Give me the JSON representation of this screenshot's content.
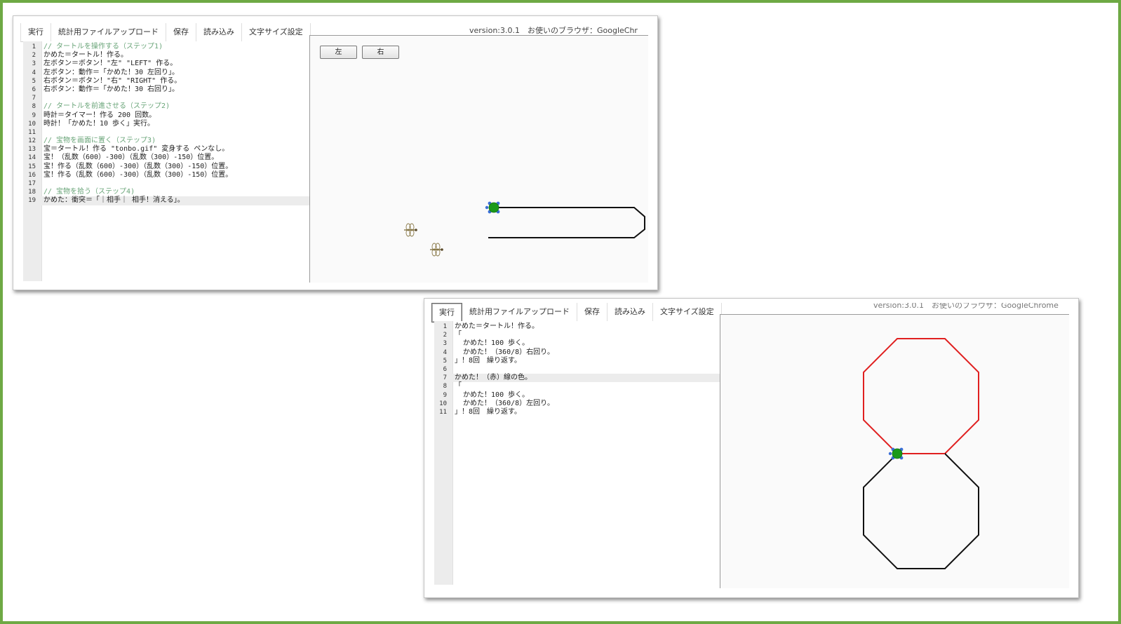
{
  "window1": {
    "toolbar": [
      "実行",
      "統計用ファイルアップロード",
      "保存",
      "読み込み",
      "文字サイズ設定"
    ],
    "version": "version:3.0.1　お使いのブラウザ：GoogleChr",
    "stage_buttons": {
      "left": "左",
      "right": "右"
    },
    "active_line": 19,
    "code": [
      {
        "n": "1",
        "text": "// タートルを操作する（ステップ1)",
        "type": "comment"
      },
      {
        "n": "2",
        "text": "かめた＝タートル！作る。",
        "type": "code"
      },
      {
        "n": "3",
        "text": "左ボタン＝ボタン！\"左\" \"LEFT\" 作る。",
        "type": "code"
      },
      {
        "n": "4",
        "text": "左ボタン：動作＝「かめた！30 左回り」。",
        "type": "code"
      },
      {
        "n": "5",
        "text": "右ボタン＝ボタン！\"右\" \"RIGHT\" 作る。",
        "type": "code"
      },
      {
        "n": "6",
        "text": "右ボタン：動作＝「かめた！30 右回り」。",
        "type": "code"
      },
      {
        "n": "7",
        "text": "",
        "type": "code"
      },
      {
        "n": "8",
        "text": "// タートルを前進させる（ステップ2)",
        "type": "comment"
      },
      {
        "n": "9",
        "text": "時計＝タイマー！作る 200 回数。",
        "type": "code"
      },
      {
        "n": "10",
        "text": "時計！「かめた！10 歩く」実行。",
        "type": "code"
      },
      {
        "n": "11",
        "text": "",
        "type": "code"
      },
      {
        "n": "12",
        "text": "// 宝物を画面に置く（ステップ3)",
        "type": "comment"
      },
      {
        "n": "13",
        "text": "宝＝タートル！作る \"tonbo.gif\" 変身する ペンなし。",
        "type": "code"
      },
      {
        "n": "14",
        "text": "宝！（乱数（600）-300）（乱数（300）-150）位置。",
        "type": "code"
      },
      {
        "n": "15",
        "text": "宝！作る（乱数（600）-300）（乱数（300）-150）位置。",
        "type": "code"
      },
      {
        "n": "16",
        "text": "宝！作る（乱数（600）-300）（乱数（300）-150）位置。",
        "type": "code"
      },
      {
        "n": "17",
        "text": "",
        "type": "code"
      },
      {
        "n": "18",
        "text": "// 宝物を拾う（ステップ4)",
        "type": "comment"
      },
      {
        "n": "19",
        "text": "かめた：衝突＝「｜相手｜ 相手！消える」。",
        "type": "code"
      }
    ]
  },
  "window2": {
    "toolbar": [
      "実行",
      "統計用ファイルアップロード",
      "保存",
      "読み込み",
      "文字サイズ設定"
    ],
    "version": "version:3.0.1　お使いのブラウザ：GoogleChrome",
    "active_line": 7,
    "code": [
      {
        "n": "1",
        "text": "かめた＝タートル！作る。",
        "type": "code"
      },
      {
        "n": "2",
        "text": "「",
        "type": "code"
      },
      {
        "n": "3",
        "text": "  かめた！100 歩く。",
        "type": "code"
      },
      {
        "n": "4",
        "text": "  かめた！（360/8）右回り。",
        "type": "code"
      },
      {
        "n": "5",
        "text": "」！8回　繰り返す。",
        "type": "code"
      },
      {
        "n": "6",
        "text": "",
        "type": "code"
      },
      {
        "n": "7",
        "text": "かめた！（赤）線の色。",
        "type": "code"
      },
      {
        "n": "8",
        "text": "「",
        "type": "code"
      },
      {
        "n": "9",
        "text": "  かめた！100 歩く。",
        "type": "code"
      },
      {
        "n": "10",
        "text": "  かめた！（360/8）左回り。",
        "type": "code"
      },
      {
        "n": "11",
        "text": "」！8回　繰り返す。",
        "type": "code"
      }
    ]
  },
  "colors": {
    "frame_border": "#6ea944",
    "pen_black": "#111111",
    "pen_red": "#e02020",
    "turtle_body": "#1a9a1a",
    "turtle_limbs": "#3a6fd8",
    "comment": "#6aa579"
  },
  "icons": [
    "turtle-icon",
    "dragonfly-icon"
  ]
}
